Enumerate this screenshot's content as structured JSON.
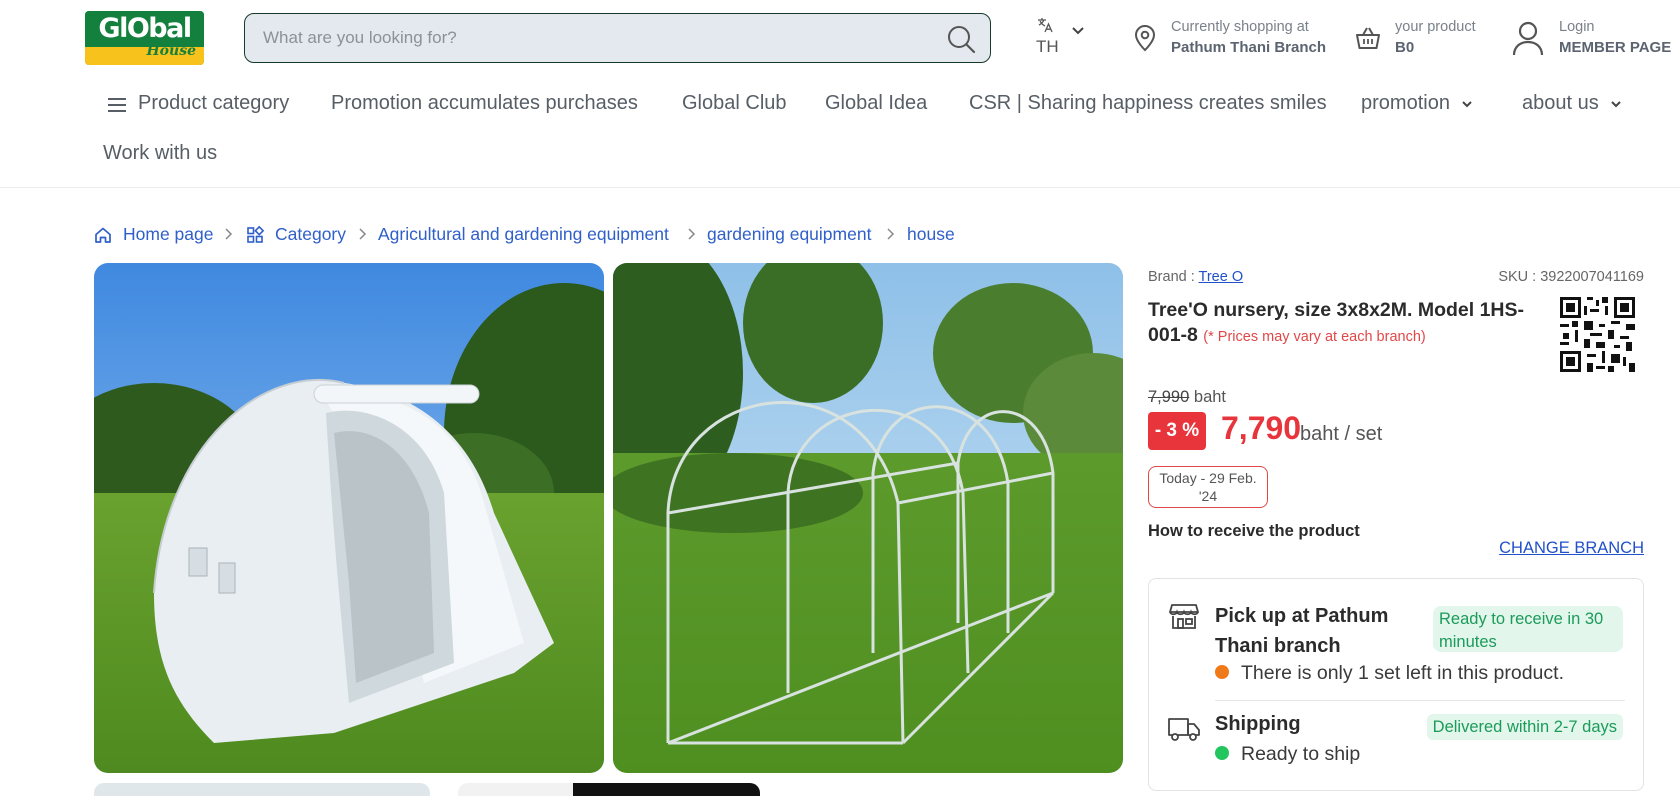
{
  "header": {
    "logo_text": "GlObal",
    "logo_sub": "House",
    "search_placeholder": "What are you looking for?",
    "language": "TH",
    "branch_label": "Currently shopping at",
    "branch_name": "Pathum Thani Branch",
    "cart_label": "your product",
    "cart_value": "B0",
    "login_label": "Login",
    "member_label": "MEMBER PAGE"
  },
  "nav": {
    "items": [
      "Product category",
      "Promotion accumulates purchases",
      "Global Club",
      "Global Idea",
      "CSR | Sharing happiness creates smiles",
      "promotion",
      "about us",
      "Work with us"
    ]
  },
  "breadcrumb": [
    "Home page",
    "Category",
    "Agricultural and gardening equipment",
    "gardening equipment",
    "house"
  ],
  "product": {
    "brand_label": "Brand :",
    "brand": "Tree O",
    "sku": "SKU : 3922007041169",
    "title": "Tree'O nursery, size 3x8x2M. Model 1HS-001-8",
    "price_note": "(* Prices may vary at each branch)",
    "old_price": "7,990",
    "old_price_unit": "baht",
    "discount": "- 3 %",
    "price": "7,790",
    "price_unit": "baht / set",
    "date_range": "Today - 29 Feb. '24"
  },
  "receive": {
    "title": "How to receive the product",
    "change_branch": "CHANGE BRANCH",
    "pickup_title": "Pick up at Pathum Thani branch",
    "pickup_badge": "Ready to receive in 30 minutes",
    "stock_text": "There is only 1 set left in this product.",
    "shipping_title": "Shipping",
    "shipping_badge": "Delivered within 2-7 days",
    "shipping_status": "Ready to ship"
  },
  "colors": {
    "brand_green": "#13803d",
    "brand_yellow": "#f6c21b",
    "link_blue": "#2f5fc8",
    "price_red": "#e8343b",
    "ready_green": "#1b9b5a",
    "stock_orange": "#f07a1a",
    "ship_dot_green": "#22c55e"
  },
  "icons": [
    "search-icon",
    "translate-icon",
    "chevron-down-icon",
    "location-pin-icon",
    "basket-icon",
    "user-icon",
    "hamburger-icon",
    "home-icon",
    "category-grid-icon",
    "chevron-right-icon",
    "qr-code-icon",
    "store-icon",
    "truck-icon"
  ]
}
